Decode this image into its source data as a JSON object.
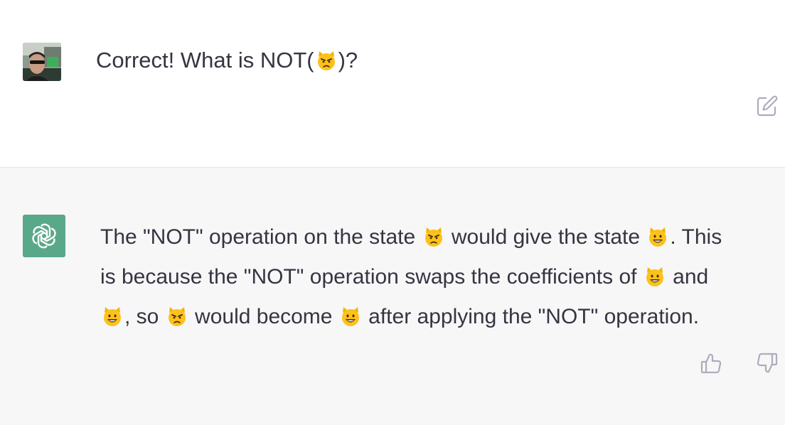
{
  "conversation": {
    "user_message": {
      "text_before_emoji": "Correct! What is NOT(",
      "emoji": "pouting-cat",
      "text_after_emoji": ")?",
      "avatar": "user-photo-avatar"
    },
    "assistant_message": {
      "avatar": "openai-logo-avatar",
      "avatar_color": "#5aa88a",
      "lines": [
        {
          "t1": "The \"NOT\" operation on the state ",
          "e1": "pouting-cat",
          "t2": " would give the state ",
          "e2": "smiling-cat",
          "t3": ". This"
        },
        {
          "t1": "is because the \"NOT\" operation swaps the coefficients of ",
          "e1": "smiling-cat",
          "t2": " and"
        },
        {
          "e1": "smiling-cat",
          "t1": ", so ",
          "e2": "pouting-cat",
          "t2": " would become ",
          "e3": "smiling-cat",
          "t3": " after applying the \"NOT\" operation."
        }
      ]
    },
    "actions": {
      "edit_icon": "edit-icon",
      "thumbs_up_icon": "thumbs-up-icon",
      "thumbs_down_icon": "thumbs-down-icon"
    }
  },
  "colors": {
    "text": "#343541",
    "assistant_bg": "#f7f7f8",
    "divider": "#e5e5e6",
    "icon": "#acacbe"
  }
}
